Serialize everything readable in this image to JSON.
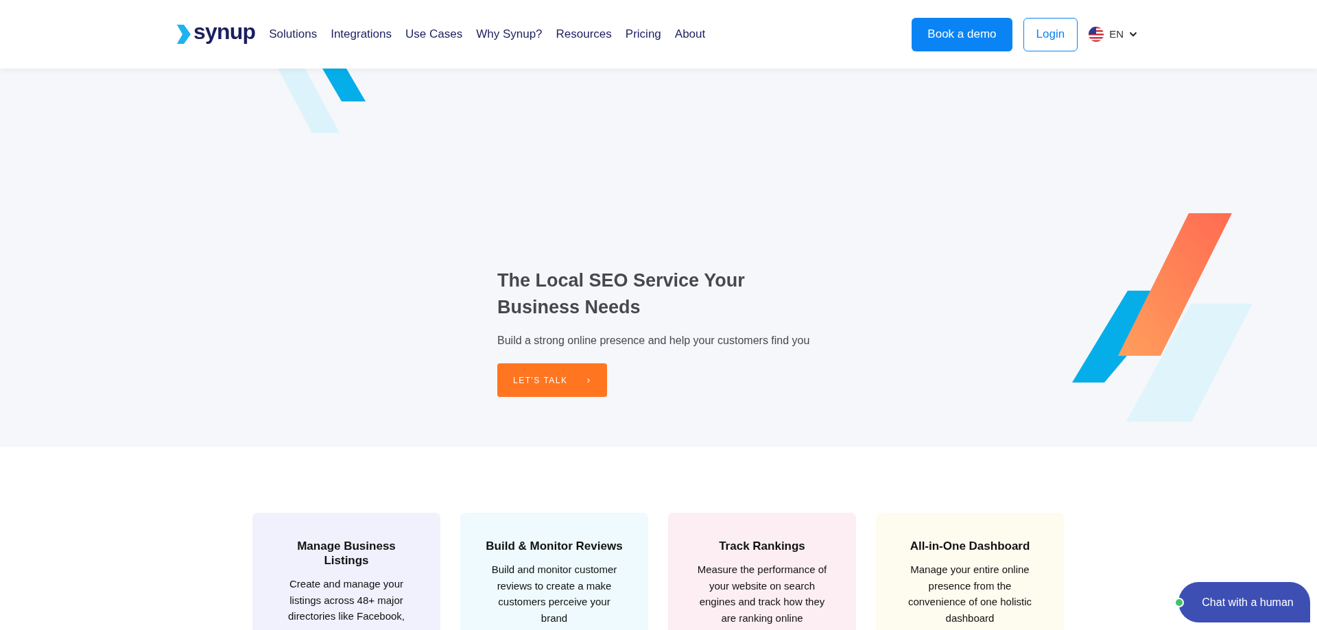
{
  "header": {
    "logo": "synup",
    "nav": [
      "Solutions",
      "Integrations",
      "Use Cases",
      "Why Synup?",
      "Resources",
      "Pricing",
      "About"
    ],
    "demo_button": "Book a demo",
    "login_button": "Login",
    "language": "EN"
  },
  "hero": {
    "title": "The Local SEO Service Your Business Needs",
    "subtitle": "Build a strong online presence and help your customers find you",
    "cta": "LET'S TALK",
    "cta_icon": "›"
  },
  "features": [
    {
      "title": "Manage Business Listings",
      "text": "Create and manage your listings across 48+ major directories like Facebook,",
      "color": "#f1f0fd"
    },
    {
      "title": "Build & Monitor Reviews",
      "text": "Build and monitor customer reviews to create a make customers perceive your brand",
      "color": "#eefafd"
    },
    {
      "title": "Track Rankings",
      "text": "Measure the performance of your website on search engines and track how they are ranking online",
      "color": "#fdeef3"
    },
    {
      "title": "All-in-One Dashboard",
      "text": "Manage your entire online presence from the convenience of one holistic dashboard",
      "color": "#fefbef"
    }
  ],
  "chat": {
    "label": "Chat with a human",
    "online": true
  }
}
